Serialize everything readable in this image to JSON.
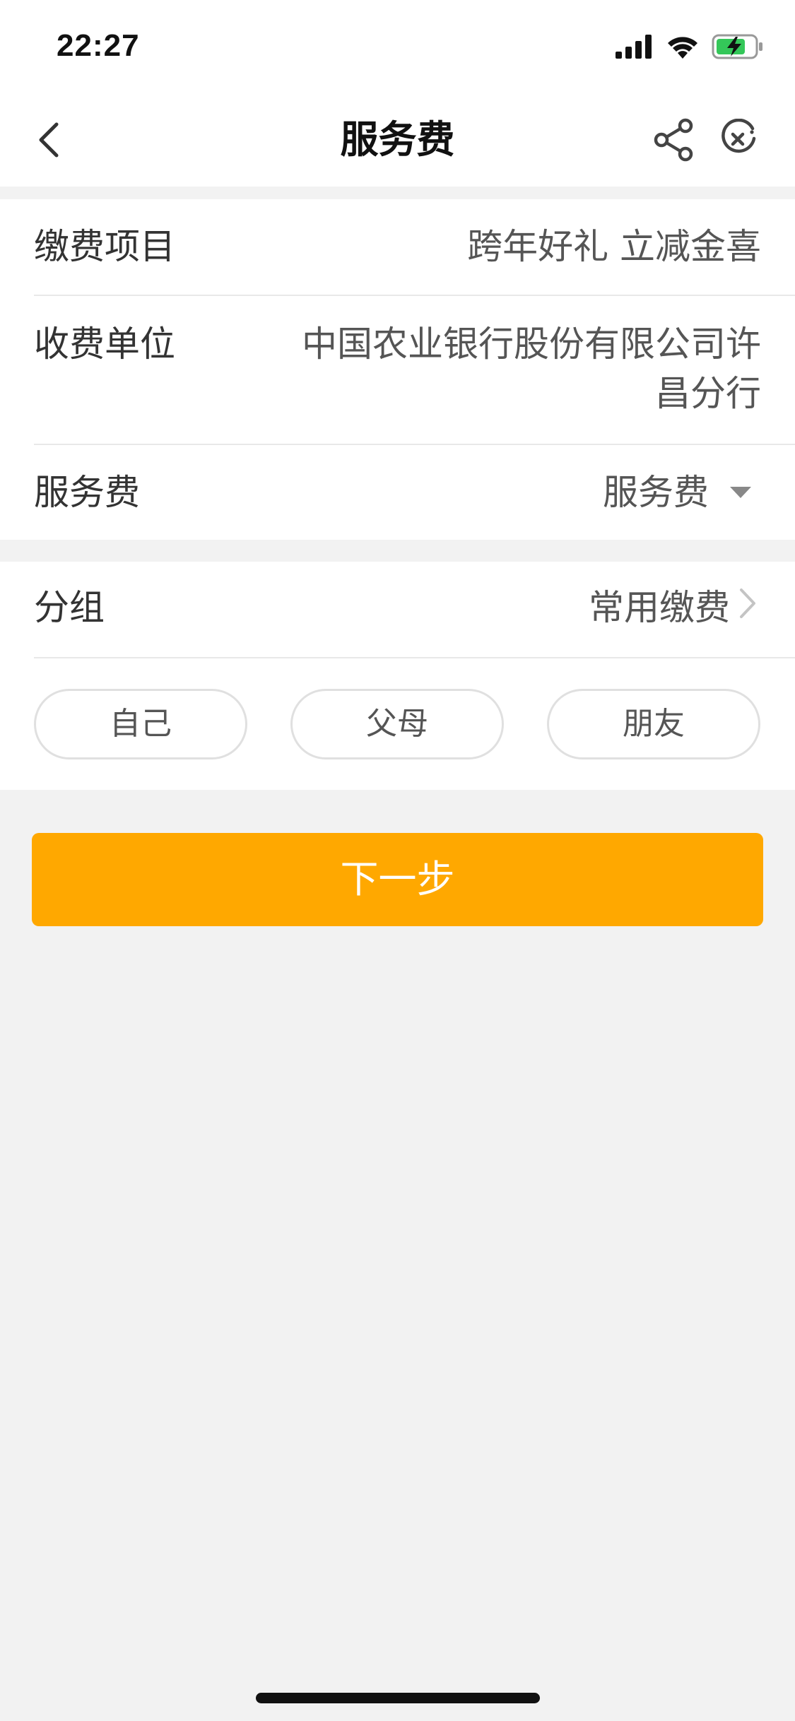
{
  "status_bar": {
    "time": "22:27"
  },
  "header": {
    "title": "服务费"
  },
  "form": {
    "item_label": "缴费项目",
    "item_value": "跨年好礼 立减金喜",
    "payee_label": "收费单位",
    "payee_line1": "中国农业银行股份有限公司许",
    "payee_line2": "昌分行",
    "fee_label": "服务费",
    "fee_value": "服务费"
  },
  "group": {
    "label": "分组",
    "value": "常用缴费",
    "options": [
      "自己",
      "父母",
      "朋友"
    ]
  },
  "actions": {
    "next_label": "下一步"
  },
  "colors": {
    "accent": "#ffa800",
    "background": "#f2f2f2"
  }
}
